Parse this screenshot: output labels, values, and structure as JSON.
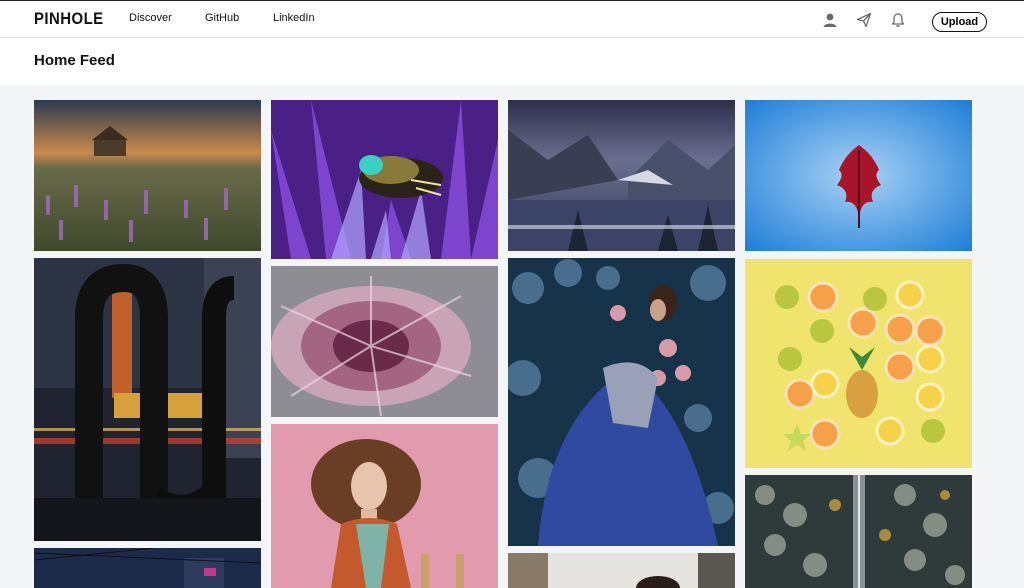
{
  "header": {
    "logo": "PINHOLE",
    "nav": [
      "Discover",
      "GitHub",
      "LinkedIn"
    ],
    "icons": [
      "user-icon",
      "send-icon",
      "bell-icon"
    ],
    "upload_label": "Upload"
  },
  "page": {
    "title": "Home Feed"
  },
  "feed": {
    "photos": [
      "photo-church-lupines-sunset",
      "photo-bee-purple-flower",
      "photo-yosemite-valley",
      "photo-red-leaf-in-ice",
      "photo-chicago-theatre-night",
      "photo-pink-chrysanthemum",
      "photo-woman-in-flowers-blue-dress",
      "photo-citrus-slices-yellow",
      "photo-forest-road-aerial",
      "photo-woman-curly-hair-pink",
      "photo-city-street-partial",
      "photo-portrait-window-partial"
    ]
  },
  "colors": {
    "page_bg": "#f4f5f7",
    "header_bg": "#ffffff",
    "text": "#111111"
  }
}
